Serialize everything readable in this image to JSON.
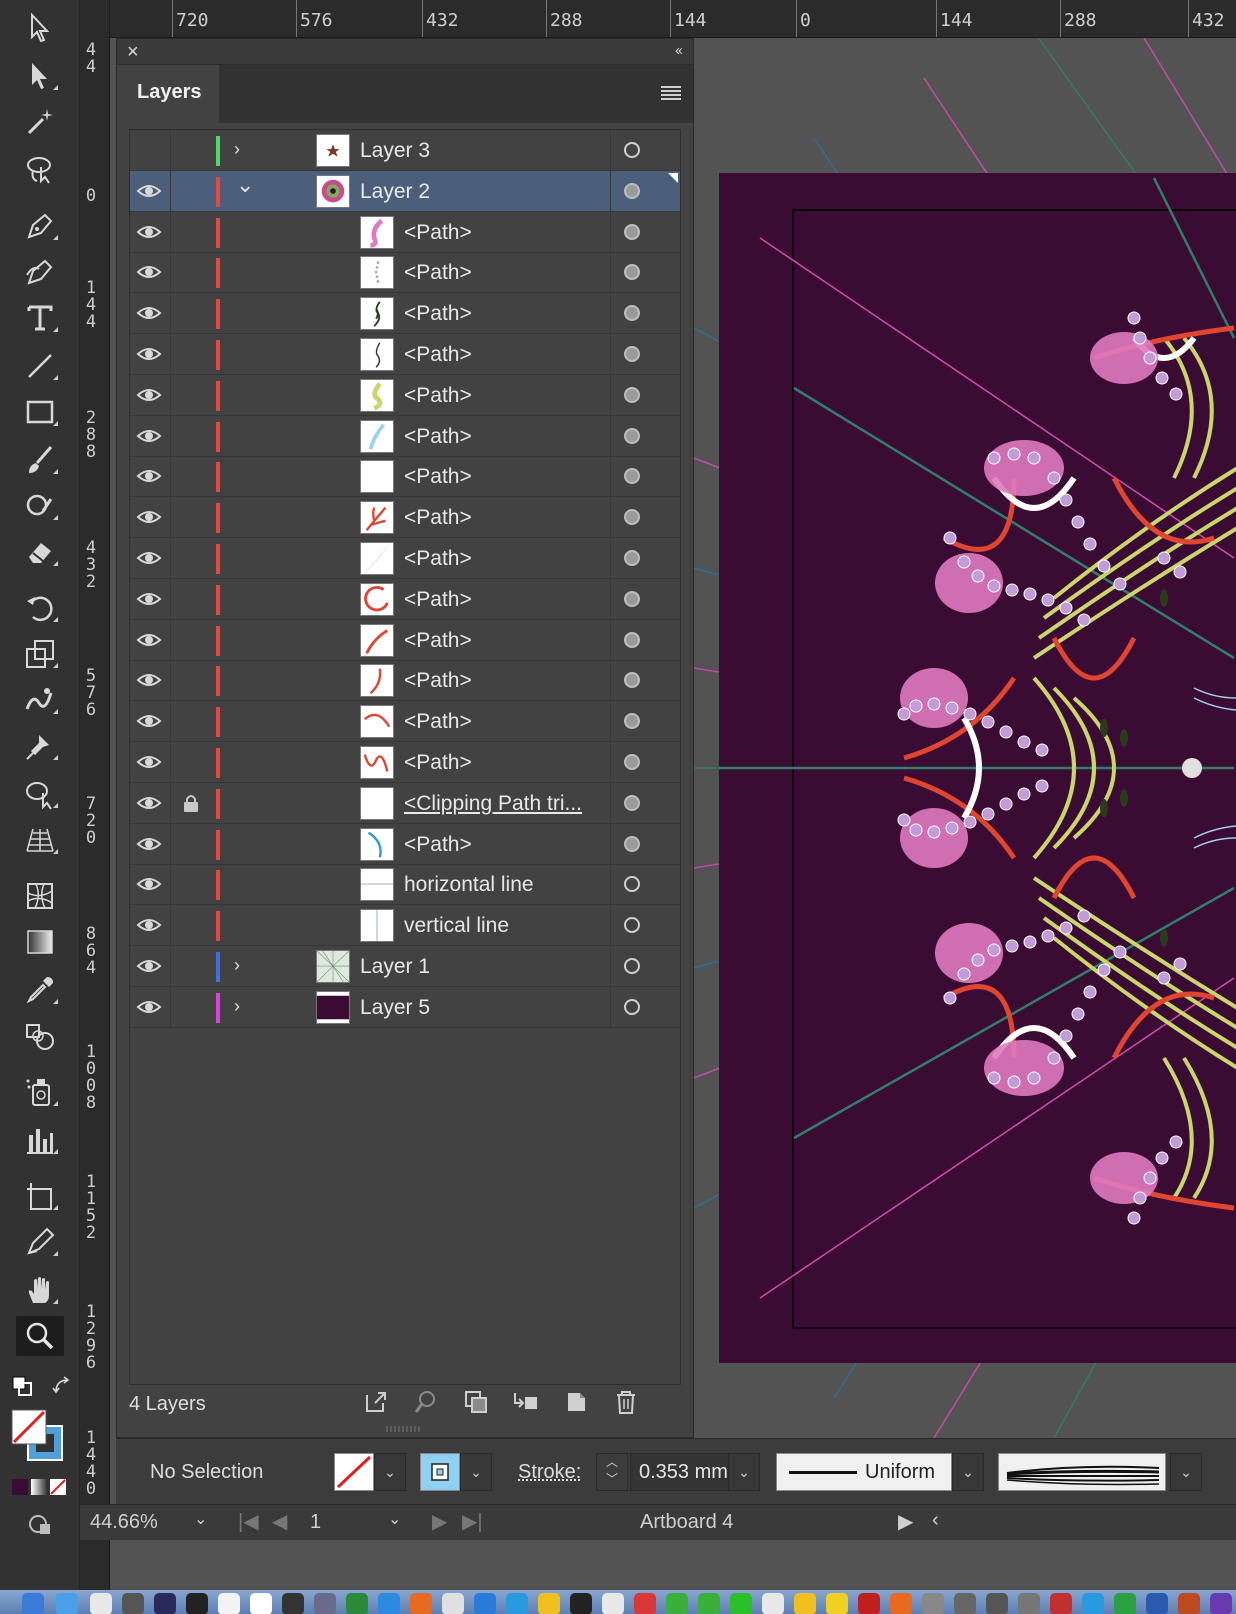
{
  "hruler": {
    "labels": [
      "720",
      "576",
      "432",
      "288",
      "144",
      "0",
      "144",
      "288",
      "432"
    ]
  },
  "vruler": {
    "labels": [
      "4\n4",
      "0",
      "1\n4\n4",
      "2\n8\n8",
      "4\n3\n2",
      "5\n7\n6",
      "7\n2\n0",
      "8\n6\n4",
      "1\n0\n0\n8",
      "1\n1\n5\n2",
      "1\n2\n9\n6",
      "1\n4\n4\n0"
    ]
  },
  "panel": {
    "tab_label": "Layers",
    "layers_count": "4 Layers",
    "rows": [
      {
        "label": "Layer 3",
        "level": "top",
        "expander": "›",
        "color": "#4cd964",
        "visible": false,
        "locked": false,
        "selected": false,
        "thumb": "star"
      },
      {
        "label": "Layer 2",
        "level": "top",
        "expander": "⌄",
        "color": "#e5483f",
        "visible": true,
        "locked": false,
        "selected": true,
        "thumb": "mandala"
      },
      {
        "label": "<Path>",
        "level": "child",
        "color": "#e5483f",
        "visible": true,
        "thumb": "pink"
      },
      {
        "label": "<Path>",
        "level": "child",
        "color": "#e5483f",
        "visible": true,
        "thumb": "dots"
      },
      {
        "label": "<Path>",
        "level": "child",
        "color": "#e5483f",
        "visible": true,
        "thumb": "dark"
      },
      {
        "label": "<Path>",
        "level": "child",
        "color": "#e5483f",
        "visible": true,
        "thumb": "dark2"
      },
      {
        "label": "<Path>",
        "level": "child",
        "color": "#e5483f",
        "visible": true,
        "thumb": "green"
      },
      {
        "label": "<Path>",
        "level": "child",
        "color": "#e5483f",
        "visible": true,
        "thumb": "blue"
      },
      {
        "label": "<Path>",
        "level": "child",
        "color": "#e5483f",
        "visible": true,
        "thumb": "blank"
      },
      {
        "label": "<Path>",
        "level": "child",
        "color": "#e5483f",
        "visible": true,
        "thumb": "red"
      },
      {
        "label": "<Path>",
        "level": "child",
        "color": "#e5483f",
        "visible": true,
        "thumb": "faint"
      },
      {
        "label": "<Path>",
        "level": "child",
        "color": "#e5483f",
        "visible": true,
        "thumb": "redcircle"
      },
      {
        "label": "<Path>",
        "level": "child",
        "color": "#e5483f",
        "visible": true,
        "thumb": "redline"
      },
      {
        "label": "<Path>",
        "level": "child",
        "color": "#e5483f",
        "visible": true,
        "thumb": "redcurve"
      },
      {
        "label": "<Path>",
        "level": "child",
        "color": "#e5483f",
        "visible": true,
        "thumb": "redarc"
      },
      {
        "label": "<Path>",
        "level": "child",
        "color": "#e5483f",
        "visible": true,
        "thumb": "redwave"
      },
      {
        "label": "<Clipping Path tri...",
        "level": "child",
        "color": "#e5483f",
        "visible": true,
        "locked": true,
        "thumb": "blank",
        "underline": true
      },
      {
        "label": "<Path>",
        "level": "child",
        "color": "#e5483f",
        "visible": true,
        "thumb": "bluecurve"
      },
      {
        "label": "horizontal line",
        "level": "child2",
        "color": "#e5483f",
        "visible": true,
        "thumb": "hline"
      },
      {
        "label": "vertical line",
        "level": "child2",
        "color": "#e5483f",
        "visible": true,
        "thumb": "vline"
      },
      {
        "label": "Layer 1",
        "level": "top",
        "expander": "›",
        "color": "#3f6fe0",
        "visible": true,
        "thumb": "rays"
      },
      {
        "label": "Layer 5",
        "level": "top",
        "expander": "›",
        "color": "#e040e0",
        "visible": true,
        "thumb": "purple"
      }
    ]
  },
  "controlbar": {
    "selection_status": "No Selection",
    "stroke_label": "Stroke:",
    "stroke_value": "0.353 mm",
    "profile": "Uniform"
  },
  "statusbar": {
    "zoom": "44.66%",
    "artboard_number": "1",
    "artboard_name": "Artboard 4"
  },
  "colors": {
    "artboard_bg": "#3b0c33",
    "selection_highlight": "#4b5f7a"
  }
}
